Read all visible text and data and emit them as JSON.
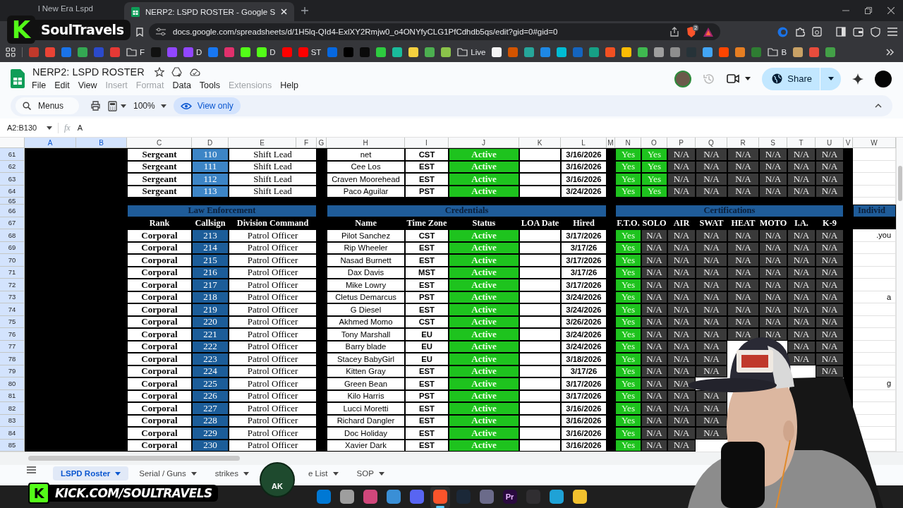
{
  "browser": {
    "tabs": [
      {
        "title": "l New Era Lspd",
        "selected": false
      },
      {
        "title": "NERP2: LSPD ROSTER - Google S",
        "selected": true
      }
    ],
    "url": "docs.google.com/spreadsheets/d/1H5lq-QId4-ExlXY2Rmjw0_o4ONYfyCLG1PfCdhdb5qs/edit?gid=0#gid=0",
    "shield_badge": "2",
    "bookmarks": [
      {
        "kind": "site",
        "color": "#c0392b"
      },
      {
        "kind": "site",
        "color": "#ea4335"
      },
      {
        "kind": "site",
        "color": "#1a73e8"
      },
      {
        "kind": "site",
        "color": "#34a853"
      },
      {
        "kind": "site",
        "color": "#2b4acb"
      },
      {
        "kind": "site",
        "color": "#e53935"
      },
      {
        "kind": "folder",
        "label": "F"
      },
      {
        "kind": "site",
        "color": "#111111"
      },
      {
        "kind": "site",
        "color": "#9146ff"
      },
      {
        "kind": "site",
        "color": "#9146ff",
        "label": "D"
      },
      {
        "kind": "site",
        "color": "#1877f2"
      },
      {
        "kind": "site",
        "color": "#e1306c"
      },
      {
        "kind": "site",
        "color": "#53fc18"
      },
      {
        "kind": "site",
        "color": "#53fc18",
        "label": "D"
      },
      {
        "kind": "site",
        "color": "#ff0000"
      },
      {
        "kind": "site",
        "color": "#ff0000",
        "label": "ST"
      },
      {
        "kind": "site",
        "color": "#0668e1"
      },
      {
        "kind": "site",
        "color": "#000000"
      },
      {
        "kind": "site",
        "color": "#0a0a0a"
      },
      {
        "kind": "site",
        "color": "#2ecc40"
      },
      {
        "kind": "site",
        "color": "#1abc9c"
      },
      {
        "kind": "site",
        "color": "#f4d03f"
      },
      {
        "kind": "site",
        "color": "#4caf50"
      },
      {
        "kind": "site",
        "color": "#8bc34a"
      },
      {
        "kind": "folder",
        "label": "Live"
      },
      {
        "kind": "site",
        "color": "#f5f5f5"
      },
      {
        "kind": "site",
        "color": "#d35400"
      },
      {
        "kind": "site",
        "color": "#26a69a"
      },
      {
        "kind": "site",
        "color": "#1e88e5"
      },
      {
        "kind": "site",
        "color": "#00bcd4"
      },
      {
        "kind": "site",
        "color": "#1565c0"
      },
      {
        "kind": "site",
        "color": "#16a085"
      },
      {
        "kind": "site",
        "color": "#f25022"
      },
      {
        "kind": "site",
        "color": "#fbbc04"
      },
      {
        "kind": "site",
        "color": "#3fb950"
      },
      {
        "kind": "site",
        "color": "#9e9e9e"
      },
      {
        "kind": "site",
        "color": "#8e8e8e"
      },
      {
        "kind": "site",
        "color": "#263238"
      },
      {
        "kind": "site",
        "color": "#42a5f5"
      },
      {
        "kind": "site",
        "color": "#ff4500"
      },
      {
        "kind": "site",
        "color": "#e67e22"
      },
      {
        "kind": "site",
        "color": "#2e7d32"
      },
      {
        "kind": "folder",
        "label": "B"
      },
      {
        "kind": "site",
        "color": "#c8a165"
      },
      {
        "kind": "site",
        "color": "#e74c3c"
      },
      {
        "kind": "site",
        "color": "#43a047"
      }
    ]
  },
  "document": {
    "title": "NERP2: LSPD ROSTER",
    "menus": [
      {
        "label": "File",
        "disabled": false
      },
      {
        "label": "Edit",
        "disabled": false
      },
      {
        "label": "View",
        "disabled": false
      },
      {
        "label": "Insert",
        "disabled": true
      },
      {
        "label": "Format",
        "disabled": true
      },
      {
        "label": "Data",
        "disabled": false
      },
      {
        "label": "Tools",
        "disabled": false
      },
      {
        "label": "Extensions",
        "disabled": true
      },
      {
        "label": "Help",
        "disabled": false
      }
    ],
    "share": "Share",
    "toolbar": {
      "search": "Menus",
      "zoom": "100%",
      "mode": "View only"
    },
    "formula_bar": {
      "cell_range": "A2:B130",
      "function_label": "fx",
      "content": "A"
    }
  },
  "sheet": {
    "columns": [
      {
        "letter": "A",
        "selected": true
      },
      {
        "letter": "B",
        "selected": true
      },
      {
        "letter": "C",
        "selected": false
      },
      {
        "letter": "D",
        "selected": false
      },
      {
        "letter": "E",
        "selected": false
      },
      {
        "letter": "F",
        "selected": false
      },
      {
        "letter": "G",
        "selected": false
      },
      {
        "letter": "H",
        "selected": false
      },
      {
        "letter": "I",
        "selected": false
      },
      {
        "letter": "J",
        "selected": false
      },
      {
        "letter": "K",
        "selected": false
      },
      {
        "letter": "L",
        "selected": false
      },
      {
        "letter": "M",
        "selected": false
      },
      {
        "letter": "N",
        "selected": false
      },
      {
        "letter": "O",
        "selected": false
      },
      {
        "letter": "P",
        "selected": false
      },
      {
        "letter": "Q",
        "selected": false
      },
      {
        "letter": "R",
        "selected": false
      },
      {
        "letter": "S",
        "selected": false
      },
      {
        "letter": "T",
        "selected": false
      },
      {
        "letter": "U",
        "selected": false
      },
      {
        "letter": "V",
        "selected": false
      },
      {
        "letter": "W",
        "selected": false
      }
    ],
    "rows": [
      {
        "number": "61",
        "kind": "data",
        "selected": true,
        "rank": "Sergeant",
        "callsign": "110",
        "color": "#3d85c6",
        "division": "Shift Lead",
        "name": "net",
        "time_zone": "CST",
        "status": "Active",
        "active": true,
        "hired": "3/16/2026",
        "certs": [
          {
            "value": "Yes",
            "held": true
          },
          {
            "value": "Yes",
            "held": true
          },
          {
            "value": "N/A",
            "held": false
          },
          {
            "value": "N/A",
            "held": false
          },
          {
            "value": "N/A",
            "held": false
          },
          {
            "value": "N/A",
            "held": false
          },
          {
            "value": "N/A",
            "held": false
          },
          {
            "value": "N/A",
            "held": false
          }
        ]
      },
      {
        "number": "62",
        "kind": "data",
        "selected": true,
        "rank": "Sergeant",
        "callsign": "111",
        "color": "#3d85c6",
        "division": "Shift Lead",
        "name": "Cee Los",
        "time_zone": "EST",
        "status": "Active",
        "active": true,
        "hired": "3/16/2026",
        "certs": [
          {
            "value": "Yes",
            "held": true
          },
          {
            "value": "Yes",
            "held": true
          },
          {
            "value": "N/A",
            "held": false
          },
          {
            "value": "N/A",
            "held": false
          },
          {
            "value": "N/A",
            "held": false
          },
          {
            "value": "N/A",
            "held": false
          },
          {
            "value": "N/A",
            "held": false
          },
          {
            "value": "N/A",
            "held": false
          }
        ]
      },
      {
        "number": "63",
        "kind": "data",
        "selected": true,
        "rank": "Sergeant",
        "callsign": "112",
        "color": "#3d85c6",
        "division": "Shift Lead",
        "name": "Craven Moorehead",
        "time_zone": "EST",
        "status": "Active",
        "active": true,
        "hired": "3/16/2026",
        "certs": [
          {
            "value": "Yes",
            "held": true
          },
          {
            "value": "Yes",
            "held": true
          },
          {
            "value": "N/A",
            "held": false
          },
          {
            "value": "N/A",
            "held": false
          },
          {
            "value": "N/A",
            "held": false
          },
          {
            "value": "N/A",
            "held": false
          },
          {
            "value": "N/A",
            "held": false
          },
          {
            "value": "N/A",
            "held": false
          }
        ]
      },
      {
        "number": "64",
        "kind": "data",
        "selected": true,
        "rank": "Sergeant",
        "callsign": "113",
        "color": "#3d85c6",
        "division": "Shift Lead",
        "name": "Paco Aguilar",
        "time_zone": "PST",
        "status": "Active",
        "active": true,
        "hired": "3/24/2026",
        "certs": [
          {
            "value": "Yes",
            "held": true
          },
          {
            "value": "Yes",
            "held": true
          },
          {
            "value": "N/A",
            "held": false
          },
          {
            "value": "N/A",
            "held": false
          },
          {
            "value": "N/A",
            "held": false
          },
          {
            "value": "N/A",
            "held": false
          },
          {
            "value": "N/A",
            "held": false
          },
          {
            "value": "N/A",
            "held": false
          }
        ]
      },
      {
        "number": "65",
        "kind": "spacer",
        "selected": true
      },
      {
        "number": "66",
        "kind": "section",
        "selected": true,
        "sections": [
          {
            "title": "Law Enforcement"
          },
          {
            "title": "Credentials"
          },
          {
            "title": "Certifications"
          },
          {
            "title": "Individ"
          }
        ]
      },
      {
        "number": "67",
        "kind": "columns",
        "selected": true,
        "headings": [
          "Rank",
          "Callsign",
          "Division Command",
          "Name",
          "Time Zone",
          "Status",
          "LOA Date",
          "Hired",
          "F.T.O.",
          "SOLO",
          "AIR",
          "SWAT",
          "HEAT",
          "MOTO",
          "I.A.",
          "K-9"
        ]
      },
      {
        "number": "68",
        "kind": "data",
        "selected": true,
        "rank": "Corporal",
        "callsign": "213",
        "color": "#1c5d99",
        "division": "Patrol Officer",
        "name": "Pilot Sanchez",
        "time_zone": "CST",
        "status": "Active",
        "active": true,
        "hired": "3/17/2026",
        "note": ".you",
        "certs": [
          {
            "value": "Yes",
            "held": true
          },
          {
            "value": "N/A",
            "held": false
          },
          {
            "value": "N/A",
            "held": false
          },
          {
            "value": "N/A",
            "held": false
          },
          {
            "value": "N/A",
            "held": false
          },
          {
            "value": "N/A",
            "held": false
          },
          {
            "value": "N/A",
            "held": false
          },
          {
            "value": "N/A",
            "held": false
          }
        ]
      },
      {
        "number": "69",
        "kind": "data",
        "selected": true,
        "rank": "Corporal",
        "callsign": "214",
        "color": "#1c5d99",
        "division": "Patrol Officer",
        "name": "Rip Wheeler",
        "time_zone": "EST",
        "status": "Active",
        "active": true,
        "hired": "3/17/26",
        "certs": [
          {
            "value": "Yes",
            "held": true
          },
          {
            "value": "N/A",
            "held": false
          },
          {
            "value": "N/A",
            "held": false
          },
          {
            "value": "N/A",
            "held": false
          },
          {
            "value": "N/A",
            "held": false
          },
          {
            "value": "N/A",
            "held": false
          },
          {
            "value": "N/A",
            "held": false
          },
          {
            "value": "N/A",
            "held": false
          }
        ]
      },
      {
        "number": "70",
        "kind": "data",
        "selected": true,
        "rank": "Corporal",
        "callsign": "215",
        "color": "#1c5d99",
        "division": "Patrol Officer",
        "name": "Nasad Burnett",
        "time_zone": "EST",
        "status": "Active",
        "active": true,
        "hired": "3/17/2026",
        "certs": [
          {
            "value": "Yes",
            "held": true
          },
          {
            "value": "N/A",
            "held": false
          },
          {
            "value": "N/A",
            "held": false
          },
          {
            "value": "N/A",
            "held": false
          },
          {
            "value": "N/A",
            "held": false
          },
          {
            "value": "N/A",
            "held": false
          },
          {
            "value": "N/A",
            "held": false
          },
          {
            "value": "N/A",
            "held": false
          }
        ]
      },
      {
        "number": "71",
        "kind": "data",
        "selected": true,
        "rank": "Corporal",
        "callsign": "216",
        "color": "#1c5d99",
        "division": "Patrol Officer",
        "name": "Dax Davis",
        "time_zone": "MST",
        "status": "Active",
        "active": true,
        "hired": "3/17/26",
        "certs": [
          {
            "value": "Yes",
            "held": true
          },
          {
            "value": "N/A",
            "held": false
          },
          {
            "value": "N/A",
            "held": false
          },
          {
            "value": "N/A",
            "held": false
          },
          {
            "value": "N/A",
            "held": false
          },
          {
            "value": "N/A",
            "held": false
          },
          {
            "value": "N/A",
            "held": false
          },
          {
            "value": "N/A",
            "held": false
          }
        ]
      },
      {
        "number": "72",
        "kind": "data",
        "selected": true,
        "rank": "Corporal",
        "callsign": "217",
        "color": "#1c5d99",
        "division": "Patrol Officer",
        "name": "Mike Lowry",
        "time_zone": "EST",
        "status": "Active",
        "active": true,
        "hired": "3/17/2026",
        "certs": [
          {
            "value": "Yes",
            "held": true
          },
          {
            "value": "N/A",
            "held": false
          },
          {
            "value": "N/A",
            "held": false
          },
          {
            "value": "N/A",
            "held": false
          },
          {
            "value": "N/A",
            "held": false
          },
          {
            "value": "N/A",
            "held": false
          },
          {
            "value": "N/A",
            "held": false
          },
          {
            "value": "N/A",
            "held": false
          }
        ]
      },
      {
        "number": "73",
        "kind": "data",
        "selected": true,
        "rank": "Corporal",
        "callsign": "218",
        "color": "#1c5d99",
        "division": "Patrol Officer",
        "name": "Cletus Demarcus",
        "time_zone": "PST",
        "status": "Active",
        "active": true,
        "hired": "3/24/2026",
        "note": "a",
        "certs": [
          {
            "value": "Yes",
            "held": true
          },
          {
            "value": "N/A",
            "held": false
          },
          {
            "value": "N/A",
            "held": false
          },
          {
            "value": "N/A",
            "held": false
          },
          {
            "value": "N/A",
            "held": false
          },
          {
            "value": "N/A",
            "held": false
          },
          {
            "value": "N/A",
            "held": false
          },
          {
            "value": "N/A",
            "held": false
          }
        ]
      },
      {
        "number": "74",
        "kind": "data",
        "selected": true,
        "rank": "Corporal",
        "callsign": "219",
        "color": "#1c5d99",
        "division": "Patrol Officer",
        "name": "G Diesel",
        "time_zone": "EST",
        "status": "Active",
        "active": true,
        "hired": "3/24/2026",
        "certs": [
          {
            "value": "Yes",
            "held": true
          },
          {
            "value": "N/A",
            "held": false
          },
          {
            "value": "N/A",
            "held": false
          },
          {
            "value": "N/A",
            "held": false
          },
          {
            "value": "N/A",
            "held": false
          },
          {
            "value": "N/A",
            "held": false
          },
          {
            "value": "N/A",
            "held": false
          },
          {
            "value": "N/A",
            "held": false
          }
        ]
      },
      {
        "number": "75",
        "kind": "data",
        "selected": true,
        "rank": "Corporal",
        "callsign": "220",
        "color": "#1c5d99",
        "division": "Patrol Officer",
        "name": "Akhmed Momo",
        "time_zone": "CST",
        "status": "Active",
        "active": true,
        "hired": "3/26/2026",
        "certs": [
          {
            "value": "Yes",
            "held": true
          },
          {
            "value": "N/A",
            "held": false
          },
          {
            "value": "N/A",
            "held": false
          },
          {
            "value": "N/A",
            "held": false
          },
          {
            "value": "N/A",
            "held": false
          },
          {
            "value": "N/A",
            "held": false
          },
          {
            "value": "N/A",
            "held": false
          },
          {
            "value": "N/A",
            "held": false
          }
        ]
      },
      {
        "number": "76",
        "kind": "data",
        "selected": true,
        "rank": "Corporal",
        "callsign": "221",
        "color": "#1c5d99",
        "division": "Patrol Officer",
        "name": "Tony Marshall",
        "time_zone": "EU",
        "status": "Active",
        "active": true,
        "hired": "3/24/2026",
        "certs": [
          {
            "value": "Yes",
            "held": true
          },
          {
            "value": "N/A",
            "held": false
          },
          {
            "value": "N/A",
            "held": false
          },
          {
            "value": "N/A",
            "held": false
          },
          {
            "value": "N/A",
            "held": false
          },
          {
            "value": "N/A",
            "held": false
          },
          {
            "value": "N/A",
            "held": false
          },
          {
            "value": "N/A",
            "held": false
          }
        ]
      },
      {
        "number": "77",
        "kind": "data",
        "selected": true,
        "rank": "Corporal",
        "callsign": "222",
        "color": "#1c5d99",
        "division": "Patrol Officer",
        "name": "Barry blade",
        "time_zone": "EU",
        "status": "Active",
        "active": true,
        "hired": "3/24/2026",
        "certs": [
          {
            "value": "Yes",
            "held": true
          },
          {
            "value": "N/A",
            "held": false
          },
          {
            "value": "N/A",
            "held": false
          },
          {
            "value": "N/A",
            "held": false
          }
        ],
        "certs_tail": [
          {
            "value": "N/A",
            "held": false
          },
          {
            "value": "N/A",
            "held": false
          }
        ]
      },
      {
        "number": "78",
        "kind": "data",
        "selected": true,
        "rank": "Corporal",
        "callsign": "223",
        "color": "#1c5d99",
        "division": "Patrol Officer",
        "name": "Stacey BabyGirl",
        "time_zone": "EU",
        "status": "Active",
        "active": true,
        "hired": "3/18/2026",
        "certs": [
          {
            "value": "Yes",
            "held": true
          },
          {
            "value": "N/A",
            "held": false
          },
          {
            "value": "N/A",
            "held": false
          },
          {
            "value": "N/A",
            "held": false
          }
        ],
        "certs_tail": [
          {
            "value": "N/A",
            "held": false
          },
          {
            "value": "N/A",
            "held": false
          }
        ]
      },
      {
        "number": "79",
        "kind": "data",
        "selected": true,
        "rank": "Corporal",
        "callsign": "224",
        "color": "#1c5d99",
        "division": "Patrol Officer",
        "name": "Kitten Gray",
        "time_zone": "EST",
        "status": "Active",
        "active": true,
        "hired": "3/17/26",
        "certs": [
          {
            "value": "Yes",
            "held": true
          },
          {
            "value": "N/A",
            "held": false
          },
          {
            "value": "N/A",
            "held": false
          },
          {
            "value": "N/A",
            "held": false
          }
        ],
        "certs_tail": [
          {
            "value": "N/A",
            "held": false
          }
        ]
      },
      {
        "number": "80",
        "kind": "data",
        "selected": true,
        "rank": "Corporal",
        "callsign": "225",
        "color": "#1c5d99",
        "division": "Patrol Officer",
        "name": "Green Bean",
        "time_zone": "EST",
        "status": "Active",
        "active": true,
        "hired": "3/17/2026",
        "note": "g",
        "certs": [
          {
            "value": "Yes",
            "held": true
          },
          {
            "value": "N/A",
            "held": false
          },
          {
            "value": "N/A",
            "held": false
          }
        ]
      },
      {
        "number": "81",
        "kind": "data",
        "selected": true,
        "rank": "Corporal",
        "callsign": "226",
        "color": "#1c5d99",
        "division": "Patrol Officer",
        "name": "Kilo Harris",
        "time_zone": "PST",
        "status": "Active",
        "active": true,
        "hired": "3/17/2026",
        "certs": [
          {
            "value": "Yes",
            "held": true
          },
          {
            "value": "N/A",
            "held": false
          },
          {
            "value": "N/A",
            "held": false
          },
          {
            "value": "N/A",
            "held": false
          }
        ]
      },
      {
        "number": "82",
        "kind": "data",
        "selected": true,
        "rank": "Corporal",
        "callsign": "227",
        "color": "#1c5d99",
        "division": "Patrol Officer",
        "name": "Lucci Moretti",
        "time_zone": "EST",
        "status": "Active",
        "active": true,
        "hired": "3/16/2026",
        "certs": [
          {
            "value": "Yes",
            "held": true
          },
          {
            "value": "N/A",
            "held": false
          },
          {
            "value": "N/A",
            "held": false
          },
          {
            "value": "N/A",
            "held": false
          }
        ]
      },
      {
        "number": "83",
        "kind": "data",
        "selected": true,
        "rank": "Corporal",
        "callsign": "228",
        "color": "#1c5d99",
        "division": "Patrol Officer",
        "name": "Richard Dangler",
        "time_zone": "EST",
        "status": "Active",
        "active": true,
        "hired": "3/16/2026",
        "certs": [
          {
            "value": "Yes",
            "held": true
          },
          {
            "value": "N/A",
            "held": false
          },
          {
            "value": "N/A",
            "held": false
          },
          {
            "value": "N/A",
            "held": false
          }
        ]
      },
      {
        "number": "84",
        "kind": "data",
        "selected": true,
        "rank": "Corporal",
        "callsign": "229",
        "color": "#1c5d99",
        "division": "Patrol Officer",
        "name": "Doc Holiday",
        "time_zone": "EST",
        "status": "Active",
        "active": true,
        "hired": "3/16/2026",
        "certs": [
          {
            "value": "Yes",
            "held": true
          },
          {
            "value": "N/A",
            "held": false
          },
          {
            "value": "N/A",
            "held": false
          },
          {
            "value": "N/A",
            "held": false
          }
        ]
      },
      {
        "number": "85",
        "kind": "data",
        "selected": true,
        "rank": "Corporal",
        "callsign": "230",
        "color": "#1c5d99",
        "division": "Patrol Officer",
        "name": "Xavier Dark",
        "time_zone": "EST",
        "status": "Active",
        "active": true,
        "hired": "3/16/2026",
        "certs": [
          {
            "value": "Yes",
            "held": true
          },
          {
            "value": "N/A",
            "held": false
          },
          {
            "value": "N/A",
            "held": false
          }
        ]
      }
    ]
  },
  "sheet_tabs": [
    {
      "label": "LSPD Roster",
      "selected": true
    },
    {
      "label": "Serial / Guns",
      "selected": false
    },
    {
      "label": "strikes",
      "selected": false
    },
    {
      "label": "e List",
      "selected": false
    },
    {
      "label": "SOP",
      "selected": false
    }
  ],
  "taskbar": [
    {
      "color": "#0078d4",
      "active": false
    },
    {
      "color": "#9e9e9e",
      "active": false
    },
    {
      "color": "#d0477b",
      "active": false
    },
    {
      "color": "#3a8fd6",
      "active": false
    },
    {
      "color": "#5865f2",
      "active": false
    },
    {
      "color": "#fb542b",
      "active": true
    },
    {
      "color": "#1b2838",
      "active": false
    },
    {
      "color": "#6b6b8a",
      "active": false
    },
    {
      "color": "#2a0a3f",
      "label": "Pr",
      "active": false
    },
    {
      "color": "#302e31",
      "active": false
    },
    {
      "color": "#1fa2d6",
      "active": false
    },
    {
      "color": "#f2c12e",
      "active": false
    }
  ],
  "stream_overlay": {
    "logo_mark": "K",
    "channel": "SoulTravels",
    "banner_mark": "K",
    "banner": "KICK.COM/SOULTRAVELS",
    "badge": "AK"
  }
}
